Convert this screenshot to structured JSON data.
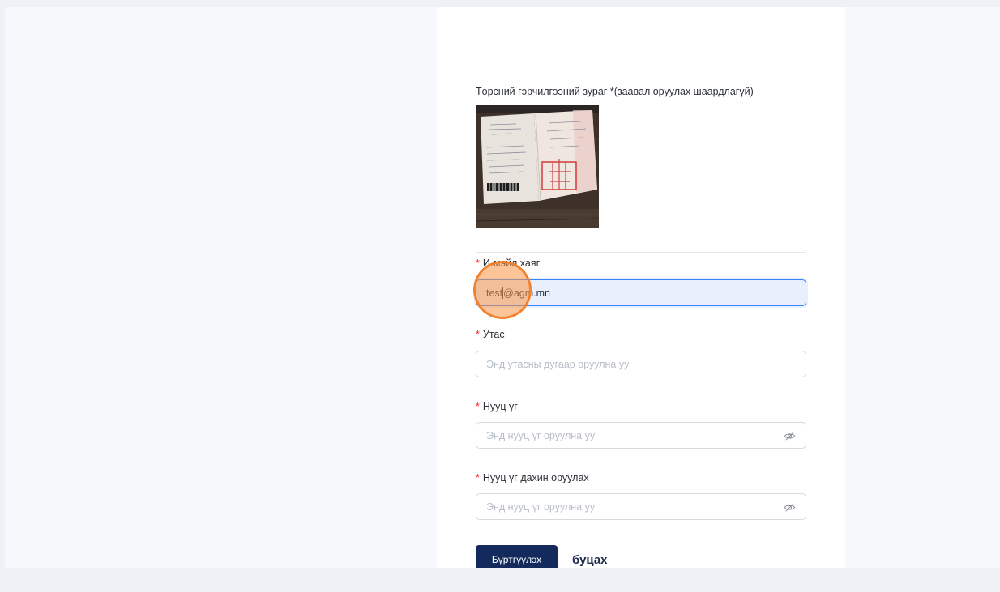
{
  "form": {
    "cert_label": "Төрсний гэрчилгээний зураг *(заавал оруулах шаардлагүй)",
    "email": {
      "label": "И-мэйл хаяг",
      "value_before_caret": "test",
      "value_after_caret": "@agm.mn"
    },
    "phone": {
      "label": "Утас",
      "placeholder": "Энд утасны дугаар оруулна уу"
    },
    "password": {
      "label": "Нууц үг",
      "placeholder": "Энд нууц үг оруулна уу"
    },
    "password_confirm": {
      "label": "Нууц үг дахин оруулах",
      "placeholder": "Энд нууц үг оруулна уу"
    },
    "required_mark": "*",
    "submit_label": "Бүртгүүлэх",
    "back_label": "буцах"
  },
  "icons": {
    "password_toggle": "eye-off-icon"
  },
  "colors": {
    "primary": "#152a5c",
    "required": "#f5222d",
    "active_field_bg": "#e8f0fe",
    "click_highlight": "#f79646"
  }
}
